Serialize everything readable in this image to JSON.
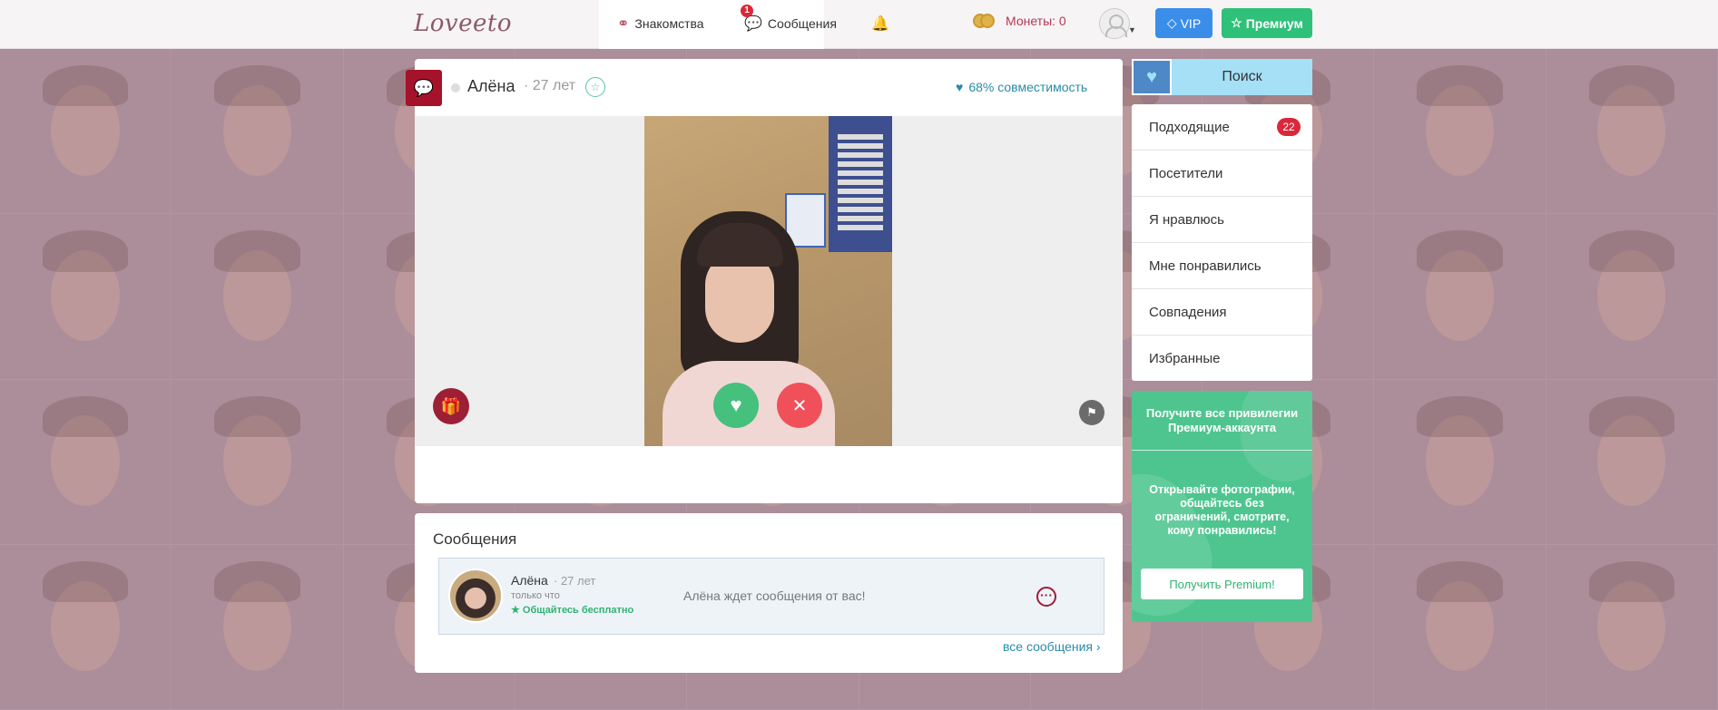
{
  "header": {
    "logo_a": "Love",
    "logo_b": "eto",
    "nav": [
      {
        "label": "Знакомства"
      },
      {
        "label": "Сообщения",
        "badge": "1"
      }
    ],
    "coins_label": "Монеты: 0",
    "vip_label": "VIP",
    "premium_label": "Премиум"
  },
  "profile": {
    "name": "Алёна",
    "age": "· 27 лет",
    "compatibility": "68% совместимость"
  },
  "messages": {
    "title": "Сообщения",
    "items": [
      {
        "name": "Алёна",
        "age": "· 27 лет",
        "time": "только что",
        "free": "Общайтесь бесплатно",
        "text": "Алёна ждет сообщения от вас!"
      }
    ],
    "all_link": "все сообщения"
  },
  "sidebar": {
    "search_label": "Поиск",
    "menu": [
      {
        "label": "Подходящие",
        "badge": "22"
      },
      {
        "label": "Посетители"
      },
      {
        "label": "Я нравлюсь"
      },
      {
        "label": "Мне понравились"
      },
      {
        "label": "Совпадения"
      },
      {
        "label": "Избранные"
      }
    ],
    "promo": {
      "head": "Получите все привилегии Премиум-аккаунта",
      "body": "Открывайте фотографии, общайтесь без ограничений, смотрите, кому понравились!",
      "button": "Получить Premium!"
    }
  },
  "colors": {
    "accent_red": "#a5132b",
    "premium_green": "#2fc07a",
    "vip_blue": "#3b8dea",
    "link_teal": "#2a8ba8"
  },
  "icons": [
    "dating-icon",
    "messages-icon",
    "bell-icon",
    "coins-icon",
    "avatar-icon",
    "diamond-icon",
    "star-icon",
    "heart-icon",
    "close-icon",
    "gift-icon",
    "flag-icon",
    "more-icon",
    "chat-icon"
  ]
}
